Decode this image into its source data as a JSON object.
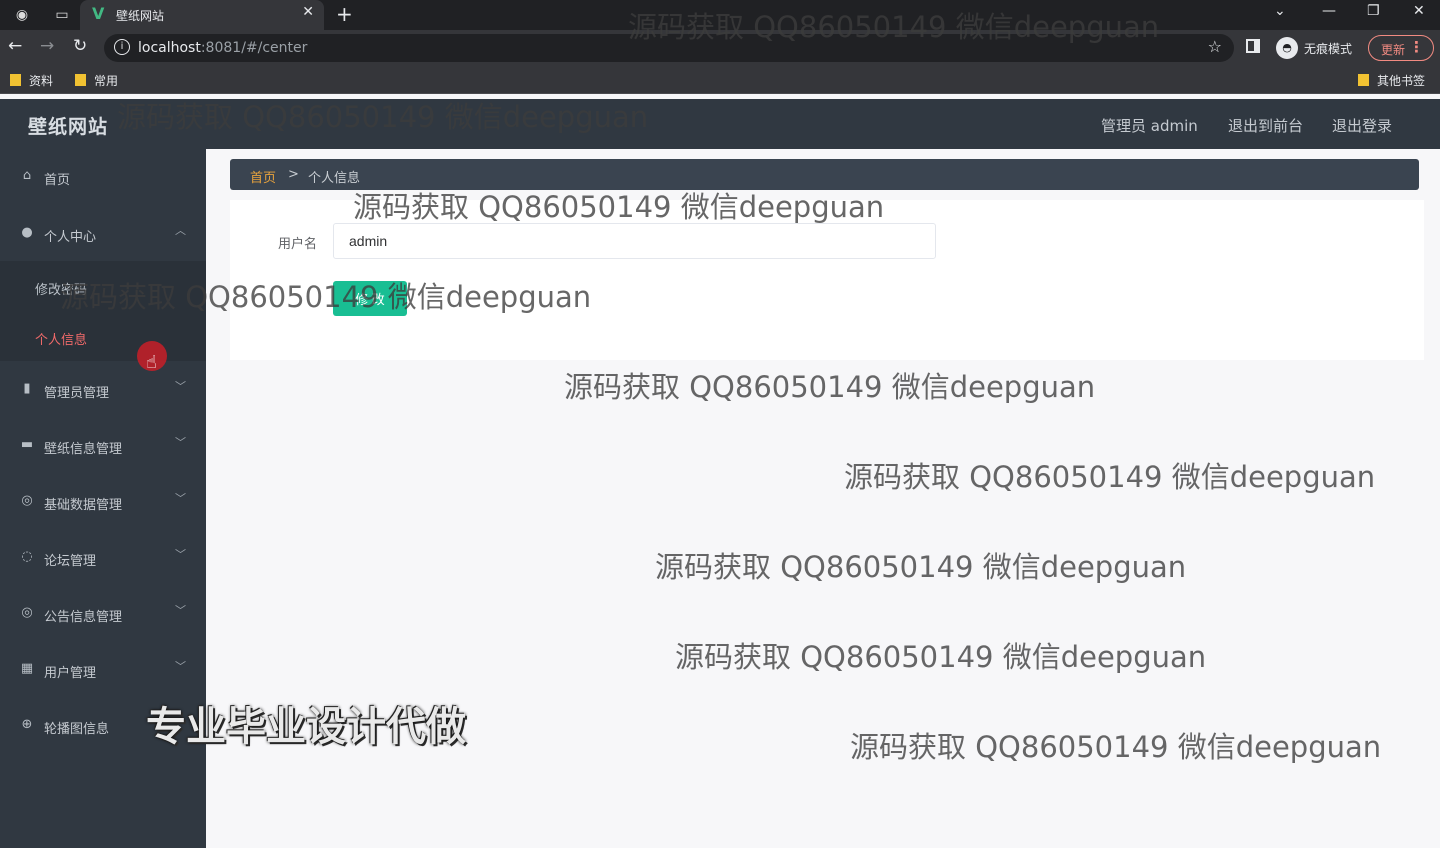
{
  "browser": {
    "tab_title": "壁纸网站",
    "tab_close": "✕",
    "new_tab": "+",
    "url_host": "localhost",
    "url_rest": ":8081/#/center",
    "incognito_label": "无痕模式",
    "update_label": "更新",
    "bookmarks": [
      "资料",
      "常用"
    ],
    "other_bookmarks": "其他书签"
  },
  "app": {
    "brand": "壁纸网站",
    "header_links": [
      "管理员 admin",
      "退出到前台",
      "退出登录"
    ]
  },
  "sidebar": {
    "items": [
      {
        "label": "首页",
        "icon": "home-icon"
      },
      {
        "label": "个人中心",
        "icon": "user-icon",
        "expanded": true,
        "children": [
          {
            "label": "修改密码",
            "active": false
          },
          {
            "label": "个人信息",
            "active": true
          }
        ]
      },
      {
        "label": "管理员管理",
        "icon": "bar-chart-icon"
      },
      {
        "label": "壁纸信息管理",
        "icon": "wallpaper-icon"
      },
      {
        "label": "基础数据管理",
        "icon": "compass-icon"
      },
      {
        "label": "论坛管理",
        "icon": "power-icon"
      },
      {
        "label": "公告信息管理",
        "icon": "compass-icon"
      },
      {
        "label": "用户管理",
        "icon": "table-icon"
      },
      {
        "label": "轮播图信息",
        "icon": "globe-icon"
      }
    ]
  },
  "breadcrumb": {
    "home": "首页",
    "separator": ">",
    "current": "个人信息"
  },
  "form": {
    "username_label": "用户名",
    "username_value": "admin",
    "submit_label": "修 改"
  },
  "watermarks": {
    "text": "源码获取 QQ86050149 微信deepguan",
    "overlay": "专业毕业设计代做"
  }
}
